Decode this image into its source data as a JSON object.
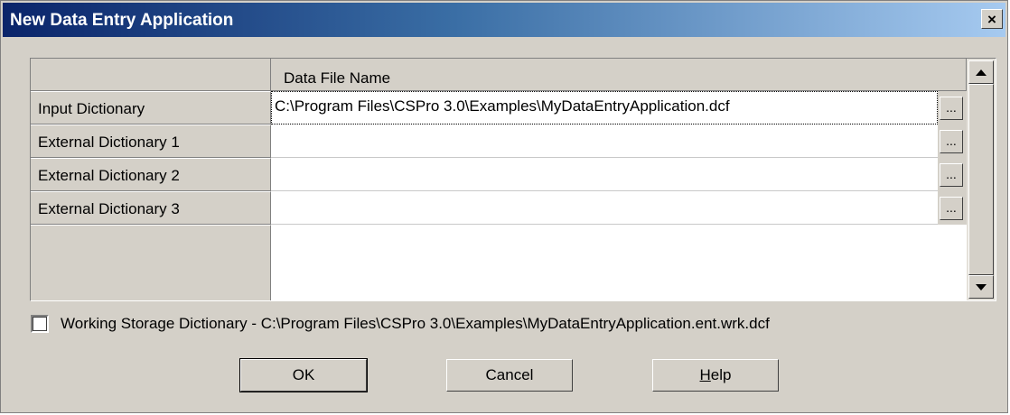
{
  "window": {
    "title": "New Data Entry Application",
    "close_label": "×"
  },
  "grid": {
    "column_header": "Data File Name",
    "rows": [
      {
        "label": "Input Dictionary",
        "value": "C:\\Program Files\\CSPro 3.0\\Examples\\MyDataEntryApplication.dcf",
        "browse": "..."
      },
      {
        "label": "External Dictionary 1",
        "value": "",
        "browse": "..."
      },
      {
        "label": "External Dictionary 2",
        "value": "",
        "browse": "..."
      },
      {
        "label": "External Dictionary 3",
        "value": "",
        "browse": "..."
      }
    ]
  },
  "working_storage": {
    "checked": false,
    "label": "Working Storage Dictionary - C:\\Program Files\\CSPro 3.0\\Examples\\MyDataEntryApplication.ent.wrk.dcf"
  },
  "buttons": {
    "ok": "OK",
    "cancel": "Cancel",
    "help_underlined": "H",
    "help_rest": "elp"
  },
  "colors": {
    "face": "#d4d0c8",
    "title_start": "#0a246a",
    "title_end": "#a6caf0"
  }
}
